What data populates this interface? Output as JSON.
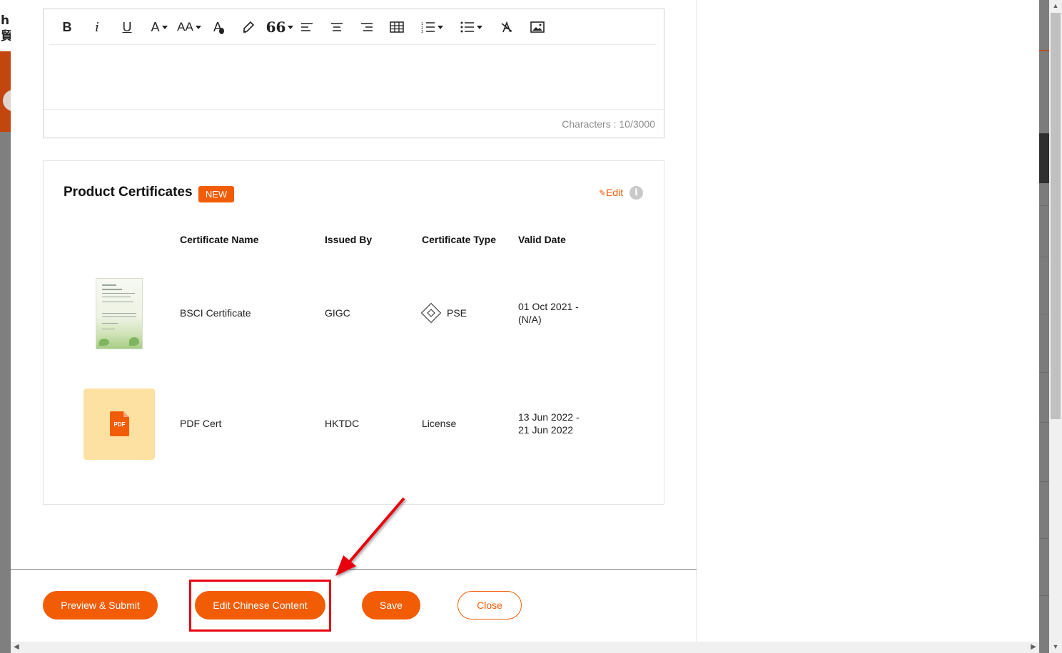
{
  "background": {
    "logo_text": "h\n貿"
  },
  "editor": {
    "toolbar_icons": [
      "bold-icon",
      "italic-icon",
      "underline-icon",
      "font-color-icon",
      "font-size-icon",
      "text-color-icon",
      "highlighter-icon",
      "quote-icon",
      "align-left-icon",
      "align-center-icon",
      "align-right-icon",
      "table-icon",
      "numbered-list-icon",
      "bulleted-list-icon",
      "clear-format-icon",
      "image-icon"
    ],
    "bold": "B",
    "italic": "i",
    "underline": "U",
    "font_color": "A",
    "font_size": "AA",
    "text_color": "A",
    "quote": "66",
    "char_count": "Characters : 10/3000"
  },
  "certificates": {
    "title": "Product Certificates",
    "badge": "NEW",
    "edit_label": "Edit",
    "info": "i",
    "headers": {
      "name": "Certificate Name",
      "issued_by": "Issued By",
      "type": "Certificate Type",
      "valid_date": "Valid Date"
    },
    "rows": [
      {
        "name": "BSCI Certificate",
        "issued_by": "GIGC",
        "type": "PSE",
        "valid_from": "01 Oct 2021 -",
        "valid_to": "(N/A)"
      },
      {
        "name": "PDF Cert",
        "issued_by": "HKTDC",
        "type": "License",
        "file_label": "PDF",
        "valid_from": "13 Jun 2022 -",
        "valid_to": "21 Jun 2022"
      }
    ]
  },
  "footer": {
    "preview_submit": "Preview & Submit",
    "edit_chinese": "Edit Chinese Content",
    "save": "Save",
    "close": "Close"
  },
  "colors": {
    "accent": "#f25c05",
    "highlight": "#e8000f",
    "badge_bg": "#f25c05",
    "pdf_bg": "#fde1a3"
  }
}
